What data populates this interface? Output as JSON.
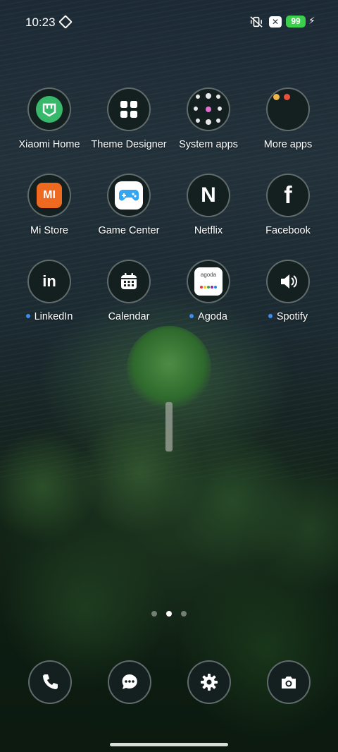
{
  "status_bar": {
    "time": "10:23",
    "battery": "99",
    "icons": [
      "gesture-diamond-icon",
      "mute-vibrate-icon",
      "x-notification-icon",
      "battery-icon",
      "charging-bolt-icon"
    ]
  },
  "apps": [
    {
      "label": "Xiaomi Home",
      "icon": "xiaomi-home-icon",
      "new": false
    },
    {
      "label": "Theme Designer",
      "icon": "theme-designer-icon",
      "new": false
    },
    {
      "label": "System apps",
      "icon": "system-apps-folder-icon",
      "new": false
    },
    {
      "label": "More apps",
      "icon": "more-apps-folder-icon",
      "new": false
    },
    {
      "label": "Mi Store",
      "icon": "mi-store-icon",
      "icon_text": "MI",
      "new": false
    },
    {
      "label": "Game Center",
      "icon": "game-center-icon",
      "new": false
    },
    {
      "label": "Netflix",
      "icon": "netflix-icon",
      "icon_text": "N",
      "new": false
    },
    {
      "label": "Facebook",
      "icon": "facebook-icon",
      "icon_text": "f",
      "new": false
    },
    {
      "label": "LinkedIn",
      "icon": "linkedin-icon",
      "icon_text": "in",
      "new": true
    },
    {
      "label": "Calendar",
      "icon": "calendar-icon",
      "new": false
    },
    {
      "label": "Agoda",
      "icon": "agoda-icon",
      "icon_text": "agoda",
      "new": true
    },
    {
      "label": "Spotify",
      "icon": "spotify-icon",
      "new": true
    }
  ],
  "pager": {
    "pages": 3,
    "current": 2
  },
  "dock": [
    {
      "icon": "phone-icon"
    },
    {
      "icon": "messages-icon"
    },
    {
      "icon": "settings-icon"
    },
    {
      "icon": "camera-icon"
    }
  ],
  "colors": {
    "new_dot": "#3d8ef0",
    "battery": "#3ccf4e",
    "icon_bg": "#14201f",
    "xiaomi_home": "#38b86a",
    "mi_store": "#ee6a20"
  }
}
